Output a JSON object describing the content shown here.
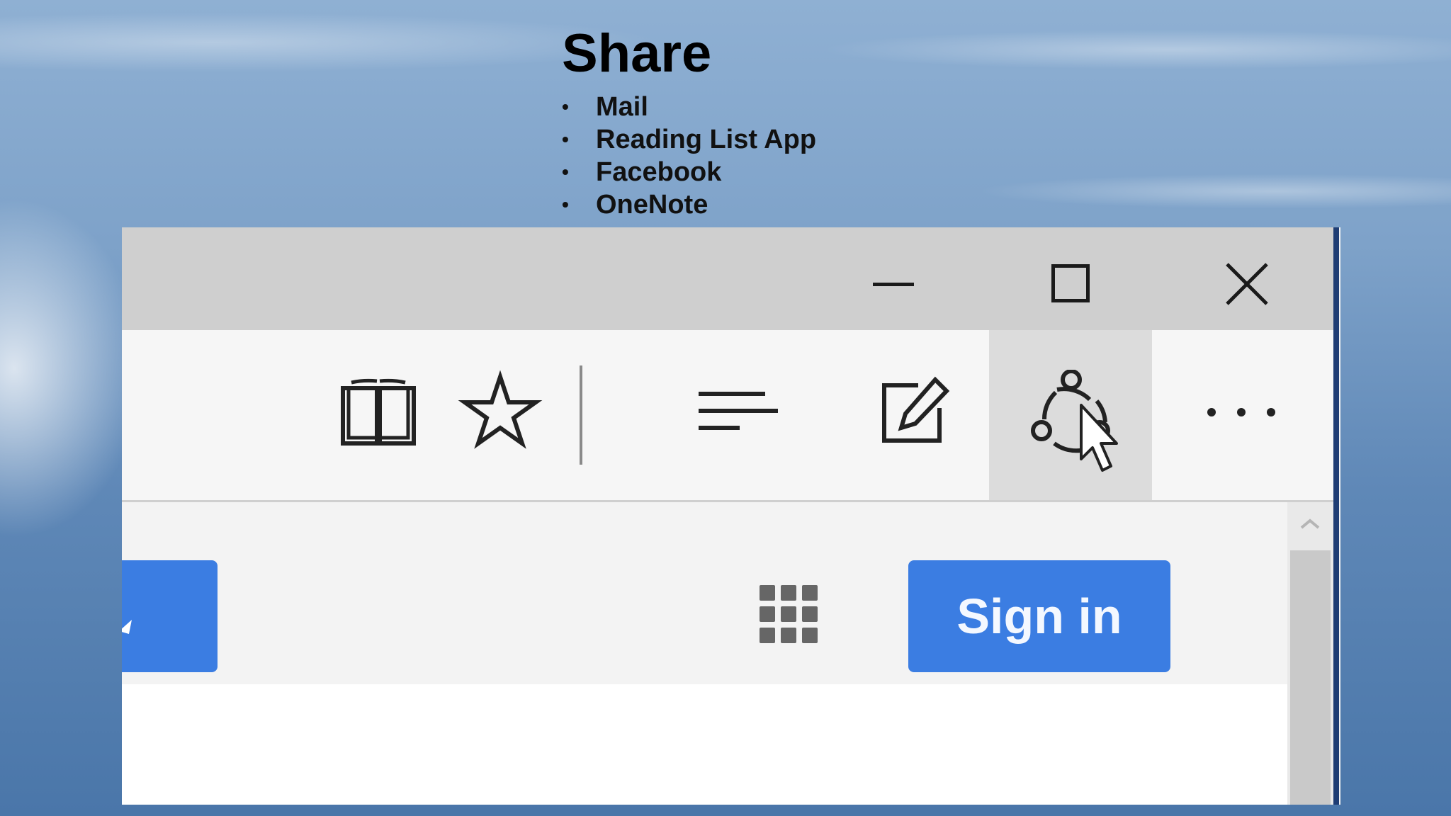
{
  "slide": {
    "title": "Share",
    "bullets": [
      "Mail",
      "Reading List App",
      "Facebook",
      "OneNote"
    ]
  },
  "window": {
    "caption_buttons": [
      "minimize-icon",
      "maximize-icon",
      "close-icon"
    ],
    "toolbar_icons": [
      "reading-view-icon",
      "favorites-star-icon",
      "hub-icon",
      "web-note-icon",
      "share-icon",
      "more-icon"
    ],
    "hovered_toolbar_item": "share-icon"
  },
  "page": {
    "sign_in_label": "Sign in",
    "apps_icon": "apps-grid-icon",
    "accent_color": "#3b7de2"
  }
}
